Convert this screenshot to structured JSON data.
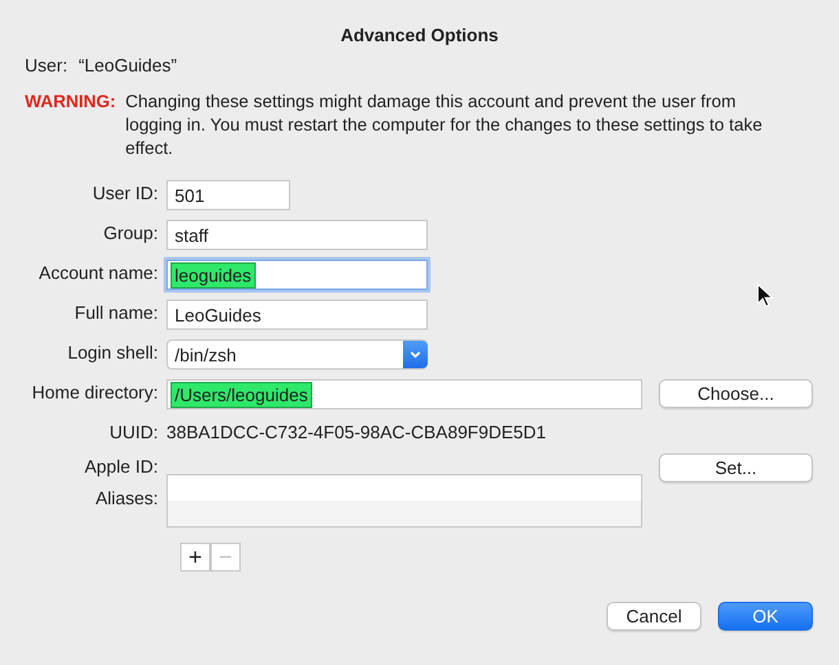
{
  "window": {
    "title": "Advanced Options"
  },
  "user": {
    "label": "User:",
    "value": "“LeoGuides”"
  },
  "warning": {
    "label": "WARNING:",
    "text": "Changing these settings might damage this account and prevent the user from logging in. You must restart the computer for the changes to these settings to take effect."
  },
  "rows": [
    {
      "kind": "short_text",
      "label": "User ID:",
      "value": "501",
      "focused": false,
      "highlighted": false
    },
    {
      "kind": "text",
      "label": "Group:",
      "value": "staff",
      "focused": false,
      "highlighted": false
    },
    {
      "kind": "text",
      "label": "Account name:",
      "value": "leoguides",
      "focused": true,
      "highlighted": true
    },
    {
      "kind": "text",
      "label": "Full name:",
      "value": "LeoGuides",
      "focused": false,
      "highlighted": false
    },
    {
      "kind": "popup",
      "label": "Login shell:",
      "value": "/bin/zsh"
    },
    {
      "kind": "long_text",
      "label": "Home directory:",
      "value": "/Users/leoguides",
      "focused": false,
      "highlighted": true,
      "button": "Choose..."
    },
    {
      "kind": "static",
      "label": "UUID:",
      "value": "38BA1DCC-C732-4F05-98AC-CBA89F9DE5D1"
    },
    {
      "kind": "empty",
      "label": "Apple ID:",
      "button": "Set..."
    },
    {
      "kind": "list",
      "label": "Aliases:"
    }
  ],
  "list_buttons": [
    {
      "label": "+",
      "disabled": false
    },
    {
      "label": "−",
      "disabled": true
    }
  ],
  "buttons": [
    {
      "label": "Cancel",
      "default": false
    },
    {
      "label": "OK",
      "default": true
    }
  ]
}
